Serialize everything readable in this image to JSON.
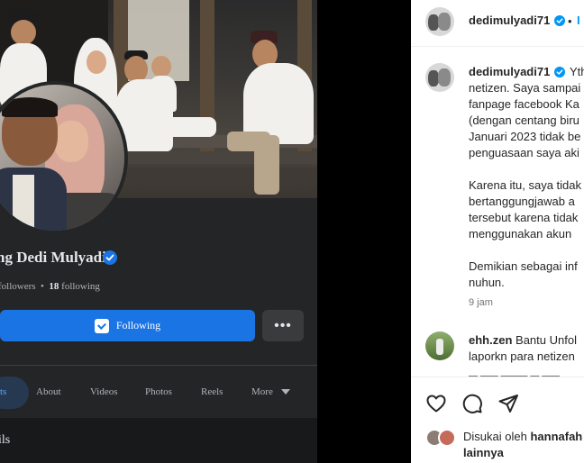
{
  "facebook": {
    "page_name": "ng Dedi Mulyadi",
    "followers_label": "followers",
    "following_count": "18",
    "following_label": "following",
    "stats_separator": "•",
    "following_button": "Following",
    "more_button": "•••",
    "tabs": [
      {
        "label": "ts",
        "active": true
      },
      {
        "label": "About"
      },
      {
        "label": "Videos"
      },
      {
        "label": "Photos"
      },
      {
        "label": "Reels"
      },
      {
        "label": "More"
      }
    ],
    "section_heading": "ils",
    "accent_color": "#1b74e4"
  },
  "instagram": {
    "header": {
      "username": "dedimulyadi71",
      "separator": "•",
      "follow_label": "I"
    },
    "caption": {
      "username": "dedimulyadi71",
      "lines": [
        "Yth",
        "netizen. Saya sampai",
        "fanpage facebook Ka",
        "(dengan centang biru",
        "Januari 2023 tidak be",
        "penguasaan saya aki",
        "",
        "Karena itu, saya tidak",
        "bertanggungjawab a",
        "tersebut karena tidak",
        "menggunakan akun",
        "",
        "Demikian sebagai inf",
        "nuhun."
      ],
      "time": "9 jam"
    },
    "comment": {
      "username": "ehh.zen",
      "line1": "Bantu Unfol",
      "line2": "laporkn para netizen"
    },
    "likes": {
      "prefix": "Disukai oleh",
      "user": "hannafah",
      "line2": "lainnya"
    },
    "verified_color": "#0095f6"
  }
}
